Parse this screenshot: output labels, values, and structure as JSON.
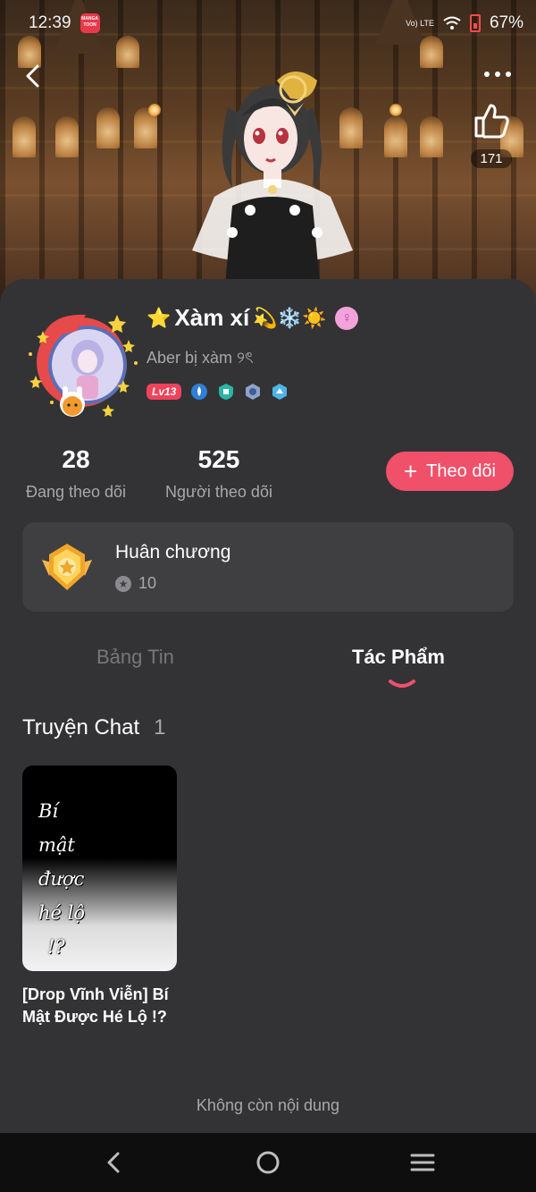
{
  "status_bar": {
    "time": "12:39",
    "app_badge": "MANGA TOON",
    "network": "Vo) LTE",
    "battery": "67%"
  },
  "banner": {
    "like_count": "171"
  },
  "profile": {
    "name_prefix": "⭐",
    "name": "Xàm xí",
    "name_suffix": "💫❄️☀️",
    "gender_symbol": "♀",
    "bio": "Aber bị xàm ୨ৎ",
    "level": "Lv13"
  },
  "stats": {
    "following_count": "28",
    "following_label": "Đang theo dõi",
    "followers_count": "525",
    "followers_label": "Người theo dõi"
  },
  "follow_button": {
    "label": "Theo dõi"
  },
  "medal": {
    "title": "Huân chương",
    "count": "10"
  },
  "tabs": [
    {
      "label": "Bảng Tin",
      "active": false
    },
    {
      "label": "Tác Phẩm",
      "active": true
    }
  ],
  "section": {
    "title": "Truyện Chat",
    "count": "1"
  },
  "story": {
    "cover_lines": [
      "Bí",
      "mật",
      "được",
      "hé lộ",
      "!?"
    ],
    "title": "[Drop Vĩnh Viễn] Bí Mật Được Hé Lộ !?"
  },
  "footer": {
    "end_text": "Không còn nội dung"
  },
  "colors": {
    "accent": "#f0506a",
    "background": "#333335",
    "card": "#3f3f42"
  }
}
